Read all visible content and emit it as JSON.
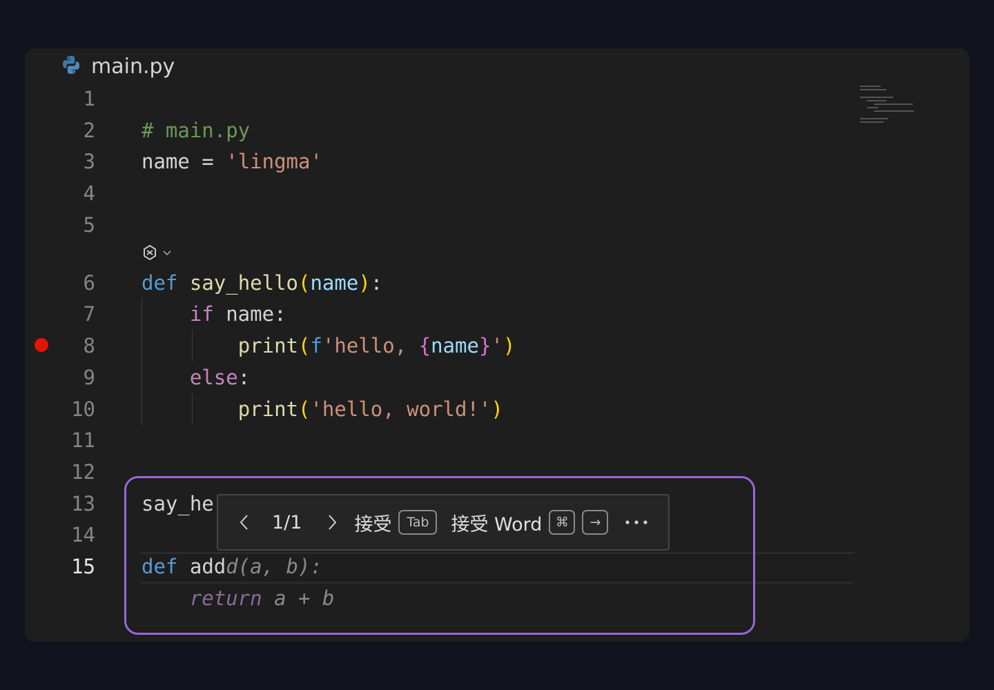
{
  "tab": {
    "filename": "main.py",
    "icon": "python-icon"
  },
  "gutter": {
    "line_numbers": [
      "1",
      "2",
      "3",
      "4",
      "5",
      "6",
      "7",
      "8",
      "9",
      "10",
      "11",
      "12",
      "13",
      "14",
      "15"
    ],
    "active_line": "15",
    "breakpoint_line": "8",
    "breakpoint_color": "#e51400"
  },
  "code": {
    "l2_comment": "# main.py",
    "l3_var": "name",
    "l3_op": " = ",
    "l3_str": "'lingma'",
    "l6_def": "def",
    "l6_fn": "say_hello",
    "l6_param": "name",
    "l7_if": "if",
    "l7_rest": " name:",
    "l8_fn": "print",
    "l8_f": "f",
    "l8_str_a": "'hello, ",
    "l8_name": "name",
    "l8_str_b": "'",
    "l9_else": "else",
    "l10_fn": "print",
    "l10_str": "'hello, world!'",
    "l13_partial": "say_he",
    "l15_def": "def",
    "l15_typed": "add",
    "l15_ghost": "d(a, b):",
    "l16_ghost_return": "return",
    "l16_ghost_rest": " a + b"
  },
  "suggestion_toolbar": {
    "prev_icon": "chevron-left-icon",
    "counter": "1/1",
    "next_icon": "chevron-right-icon",
    "accept_label": "接受",
    "accept_key": "Tab",
    "accept_word_label": "接受 Word",
    "accept_word_key_cmd": "⌘",
    "accept_word_key_arrow": "→",
    "more_icon": "ellipsis-icon"
  },
  "colors": {
    "editor_bg": "#1e1e1e",
    "page_bg": "#12121f",
    "highlight_frame": "#9a66d8"
  }
}
